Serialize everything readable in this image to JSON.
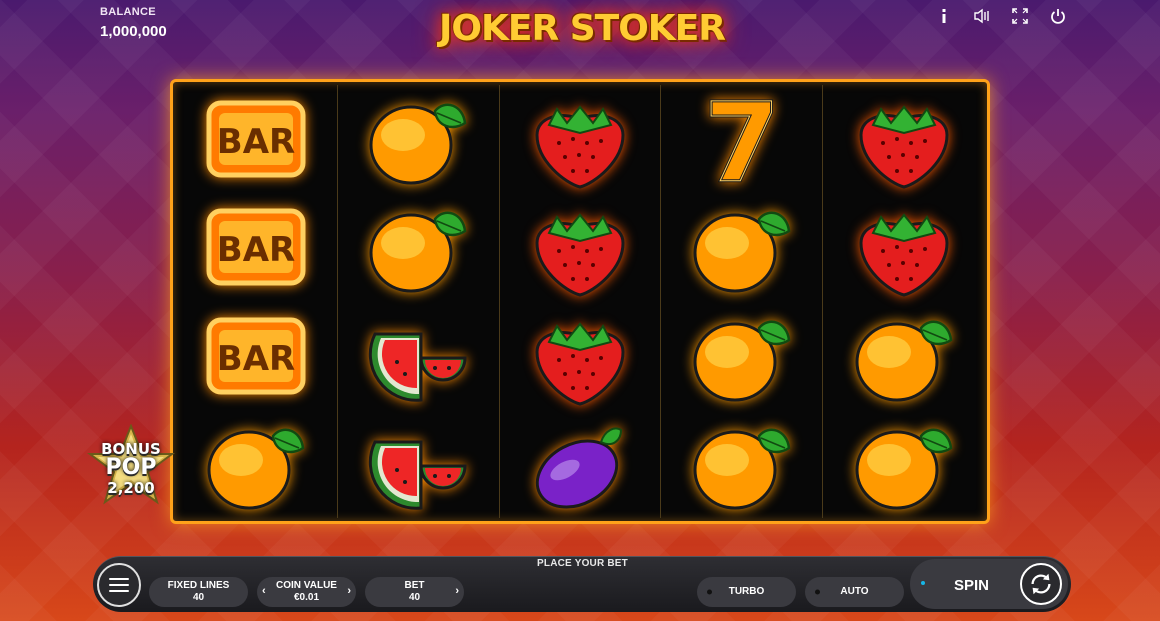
{
  "balance": {
    "label": "BALANCE",
    "value": "1,000,000"
  },
  "logo": {
    "text": "JOKER STOKER"
  },
  "top_icons": [
    "info-icon",
    "sound-icon",
    "fullscreen-icon",
    "power-icon"
  ],
  "reels": [
    [
      "bar",
      "bar",
      "bar",
      "orange"
    ],
    [
      "orange",
      "orange",
      "watermelon",
      "watermelon"
    ],
    [
      "strawberry",
      "strawberry",
      "strawberry",
      "plum"
    ],
    [
      "seven",
      "orange",
      "orange",
      "orange"
    ],
    [
      "strawberry",
      "strawberry",
      "orange",
      "orange"
    ]
  ],
  "symbols": {
    "bar_text": "BAR",
    "seven_text": "7"
  },
  "bonus": {
    "line1": "BONUS",
    "line2": "POP",
    "amount": "2,200"
  },
  "controls": {
    "place_bet": "PLACE YOUR BET",
    "fixed_lines_label": "FIXED LINES",
    "fixed_lines_value": "40",
    "coin_value_label": "COIN VALUE",
    "coin_value": "€0.01",
    "bet_label": "BET",
    "bet_value": "40",
    "turbo_label": "TURBO",
    "auto_label": "AUTO",
    "spin_label": "SPIN",
    "arrow_left": "‹",
    "arrow_right": "›"
  },
  "colors": {
    "frame": "#ffa21a",
    "accent_dot": "#17b6e6"
  }
}
